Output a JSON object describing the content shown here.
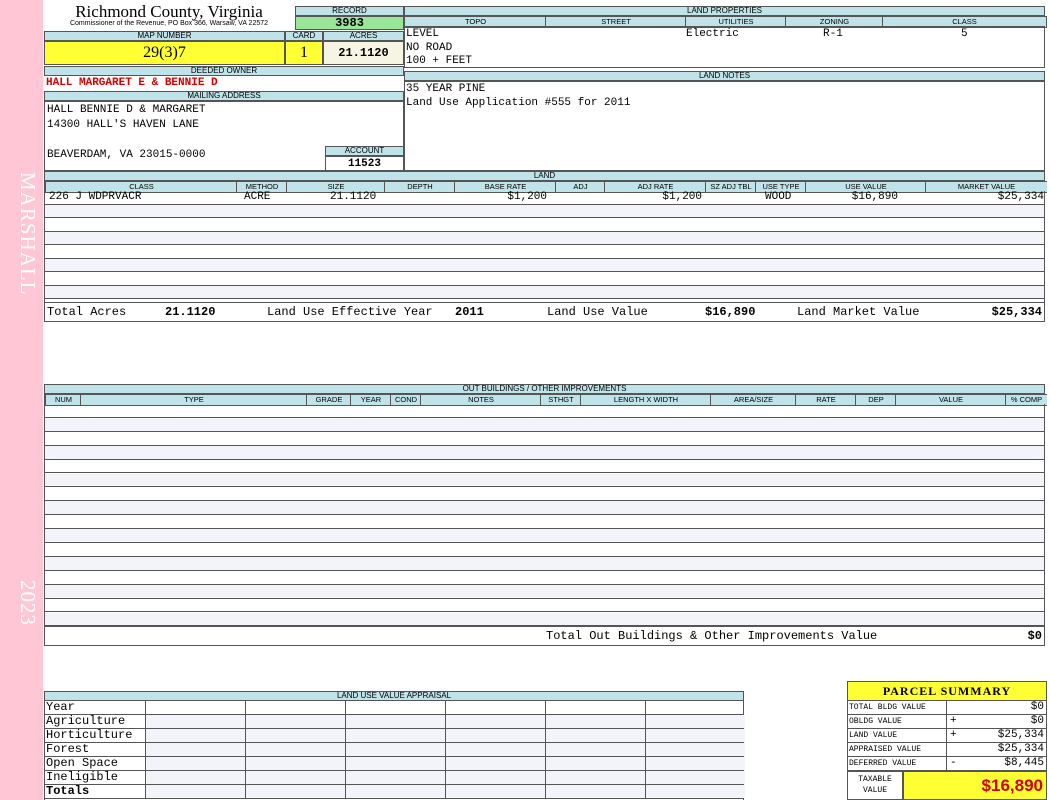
{
  "sidebar": {
    "district": "MARSHALL",
    "year": "2023"
  },
  "header": {
    "county": "Richmond County, Virginia",
    "commissioner": "Commissioner of the Revenue, PO Box 366, Warsaw, VA 22572",
    "record_label": "RECORD",
    "record": "3983",
    "map_number_label": "MAP NUMBER",
    "map_number": "29(3)7",
    "card_label": "CARD",
    "card": "1",
    "acres_label": "ACRES",
    "acres": "21.1120"
  },
  "owner": {
    "deeded_owner_label": "DEEDED OWNER",
    "deeded_owner": "HALL MARGARET E & BENNIE D",
    "mailing_address_label": "MAILING ADDRESS",
    "address_line1": "HALL BENNIE D & MARGARET",
    "address_line2": "14300 HALL'S HAVEN LANE",
    "address_line3": "BEAVERDAM, VA 23015-0000",
    "account_label": "ACCOUNT",
    "account": "11523"
  },
  "land_properties": {
    "title": "LAND PROPERTIES",
    "headers": [
      "TOPO",
      "STREET",
      "UTILITIES",
      "ZONING",
      "CLASS"
    ],
    "topo": [
      "LEVEL",
      "NO ROAD",
      "100 + FEET"
    ],
    "street": "",
    "utilities": "Electric",
    "zoning": "R-1",
    "class": "5"
  },
  "land_notes": {
    "title": "LAND NOTES",
    "lines": [
      "35 YEAR PINE",
      "Land Use Application #555 for 2011"
    ]
  },
  "land": {
    "title": "LAND",
    "headers": [
      "CLASS",
      "METHOD",
      "SIZE",
      "DEPTH",
      "BASE RATE",
      "ADJ",
      "ADJ RATE",
      "SZ ADJ TBL",
      "USE TYPE",
      "USE VALUE",
      "MARKET VALUE"
    ],
    "row": {
      "class": "226 J WDPRVACR",
      "method": "ACRE",
      "size": "21.1120",
      "base_rate": "$1,200",
      "adj_rate": "$1,200",
      "use_type": "WOOD",
      "use_value": "$16,890",
      "market_value": "$25,334"
    },
    "total_acres_label": "Total Acres",
    "total_acres": "21.1120",
    "effective_year_label": "Land Use Effective Year",
    "effective_year": "2011",
    "land_use_value_label": "Land Use Value",
    "land_use_value": "$16,890",
    "land_market_value_label": "Land Market Value",
    "land_market_value": "$25,334"
  },
  "outbuildings": {
    "title": "OUT BUILDINGS / OTHER IMPROVEMENTS",
    "headers": [
      "NUM",
      "TYPE",
      "GRADE",
      "YEAR",
      "COND",
      "NOTES",
      "STHGT",
      "LENGTH X WIDTH",
      "AREA/SIZE",
      "RATE",
      "DEP",
      "VALUE",
      "% COMP"
    ],
    "total_label": "Total Out Buildings & Other Improvements Value",
    "total_value": "$0"
  },
  "land_use_appraisal": {
    "title": "LAND USE VALUE APPRAISAL",
    "rows": [
      "Year",
      "Agriculture",
      "Horticulture",
      "Forest",
      "Open Space",
      "Ineligible",
      "Totals"
    ]
  },
  "parcel_summary": {
    "title": "PARCEL SUMMARY",
    "rows": [
      {
        "label": "TOTAL BLDG VALUE",
        "op": "",
        "value": "$0"
      },
      {
        "label": "OBLDG VALUE",
        "op": "+",
        "value": "$0"
      },
      {
        "label": "LAND VALUE",
        "op": "+",
        "value": "$25,334"
      },
      {
        "label": "APPRAISED VALUE",
        "op": "",
        "value": "$25,334"
      },
      {
        "label": "DEFERRED VALUE",
        "op": "-",
        "value": "$8,445"
      }
    ],
    "taxable_label_1": "TAXABLE",
    "taxable_label_2": "VALUE",
    "taxable_value": "$16,890"
  },
  "colors": {
    "header_bg": "#bfe3e8",
    "highlight": "#ffff33",
    "record_bg": "#99e699",
    "sidebar": "#ffc7d6",
    "owner_red": "#d40000"
  }
}
